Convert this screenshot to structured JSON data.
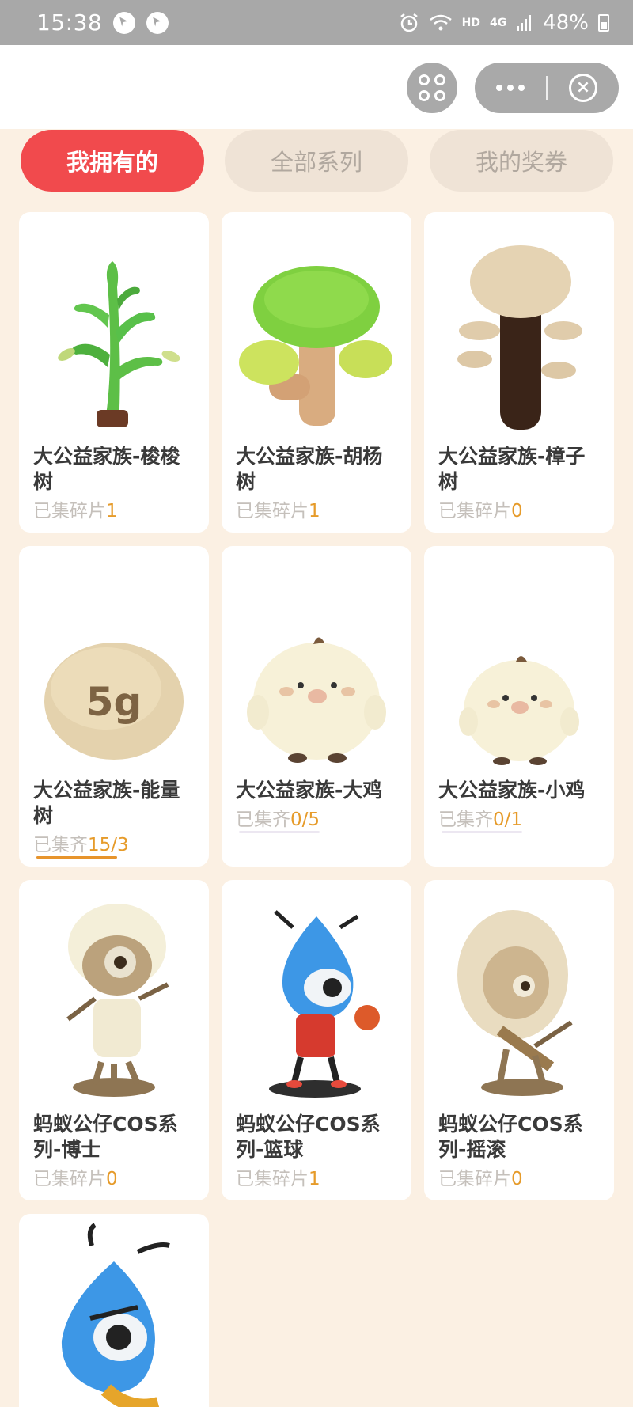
{
  "status_bar": {
    "time": "15:38",
    "net_label": "HD",
    "signal_label": "4G",
    "battery": "48%"
  },
  "tabs": [
    {
      "label": "我拥有的",
      "active": true
    },
    {
      "label": "全部系列",
      "active": false
    },
    {
      "label": "我的奖券",
      "active": false
    }
  ],
  "cards": [
    {
      "title": "大公益家族-梭梭树",
      "sub_label": "已集碎片",
      "sub_value": "1",
      "icon": "saxaul-tree-plush"
    },
    {
      "title": "大公益家族-胡杨树",
      "sub_label": "已集碎片",
      "sub_value": "1",
      "icon": "poplar-tree-plush"
    },
    {
      "title": "大公益家族-樟子树",
      "sub_label": "已集碎片",
      "sub_value": "0",
      "icon": "pine-tree-plush"
    },
    {
      "title": "大公益家族-能量树",
      "sub_label": "已集齐",
      "sub_value": "15/3",
      "icon": "energy-ball-5g",
      "ball_text": "5g",
      "progress": 1.0
    },
    {
      "title": "大公益家族-大鸡",
      "sub_label": "已集齐",
      "sub_value": "0/5",
      "icon": "big-chick-plush",
      "progress": 0
    },
    {
      "title": "大公益家族-小鸡",
      "sub_label": "已集齐",
      "sub_value": "0/1",
      "icon": "small-chick-plush",
      "progress": 0
    },
    {
      "title": "蚂蚁公仔COS系列-博士",
      "sub_label": "已集碎片",
      "sub_value": "0",
      "icon": "ant-doctor-figure"
    },
    {
      "title": "蚂蚁公仔COS系列-篮球",
      "sub_label": "已集碎片",
      "sub_value": "1",
      "icon": "ant-basketball-figure"
    },
    {
      "title": "蚂蚁公仔COS系列-摇滚",
      "sub_label": "已集碎片",
      "sub_value": "0",
      "icon": "ant-rock-figure"
    },
    {
      "title": "",
      "sub_label": "",
      "sub_value": "",
      "icon": "ant-figure-partial"
    }
  ],
  "colors": {
    "active_tab": "#f14a4d",
    "accent_number": "#e69b2a",
    "page_bg": "#fbf0e3"
  }
}
